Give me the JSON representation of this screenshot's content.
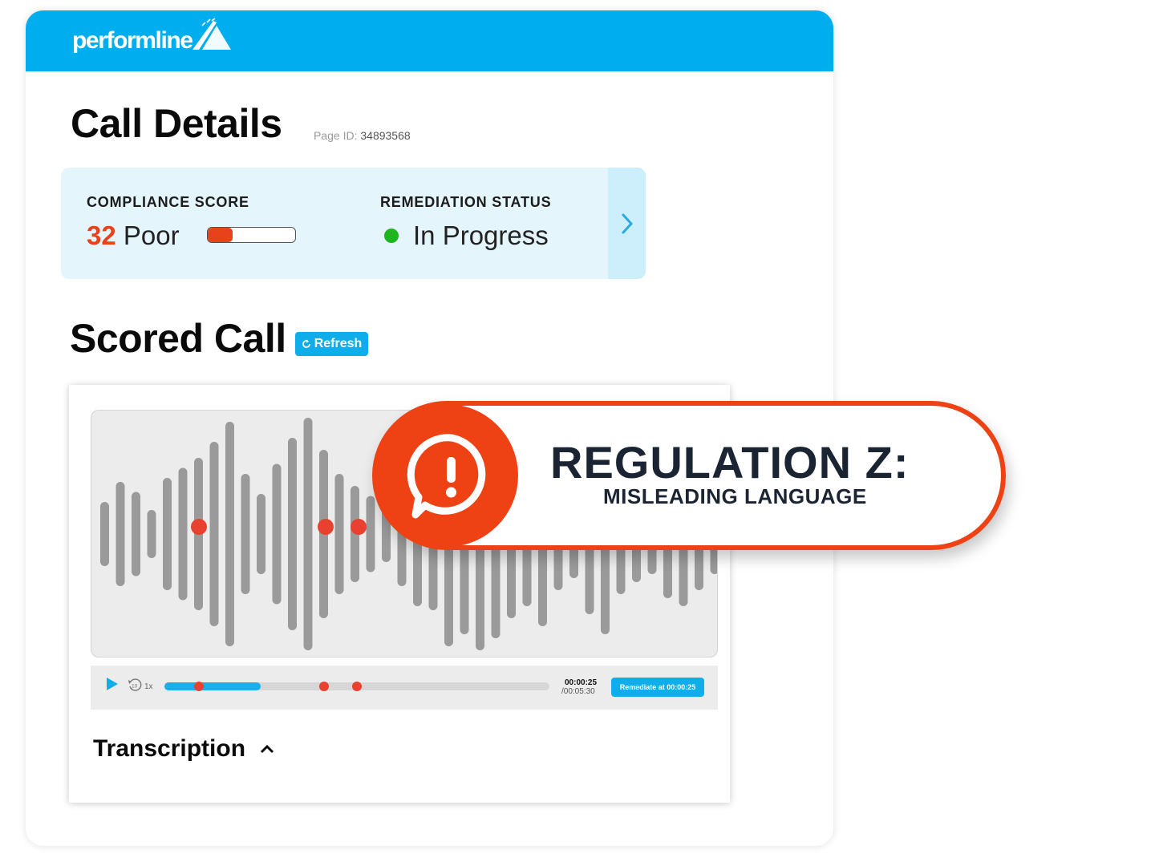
{
  "brand": {
    "logo_text": "performline"
  },
  "page": {
    "title": "Call Details",
    "page_id_label": "Page ID:",
    "page_id_value": "34893568"
  },
  "compliance": {
    "score_label": "COMPLIANCE SCORE",
    "score_number": "32",
    "score_rating": "Poor",
    "score_bar_fraction": 0.28,
    "remediation_label": "REMEDIATION STATUS",
    "remediation_status": "In Progress",
    "status_color": "#1fb51f"
  },
  "scored_call": {
    "title": "Scored Call",
    "refresh_label": "Refresh"
  },
  "player": {
    "speed": "1x",
    "current_time": "00:00:25",
    "total_time": "/00:05:30",
    "progress_fraction": 0.25,
    "flag_positions": [
      0.09,
      0.415,
      0.5
    ],
    "remediate_label": "Remediate at 00:00:25",
    "transcription_label": "Transcription"
  },
  "alert": {
    "title": "REGULATION Z:",
    "subtitle": "MISLEADING LANGUAGE",
    "accent_color": "#ef4214"
  },
  "colors": {
    "brand_blue": "#00aeef",
    "flag_red": "#e8412f"
  }
}
